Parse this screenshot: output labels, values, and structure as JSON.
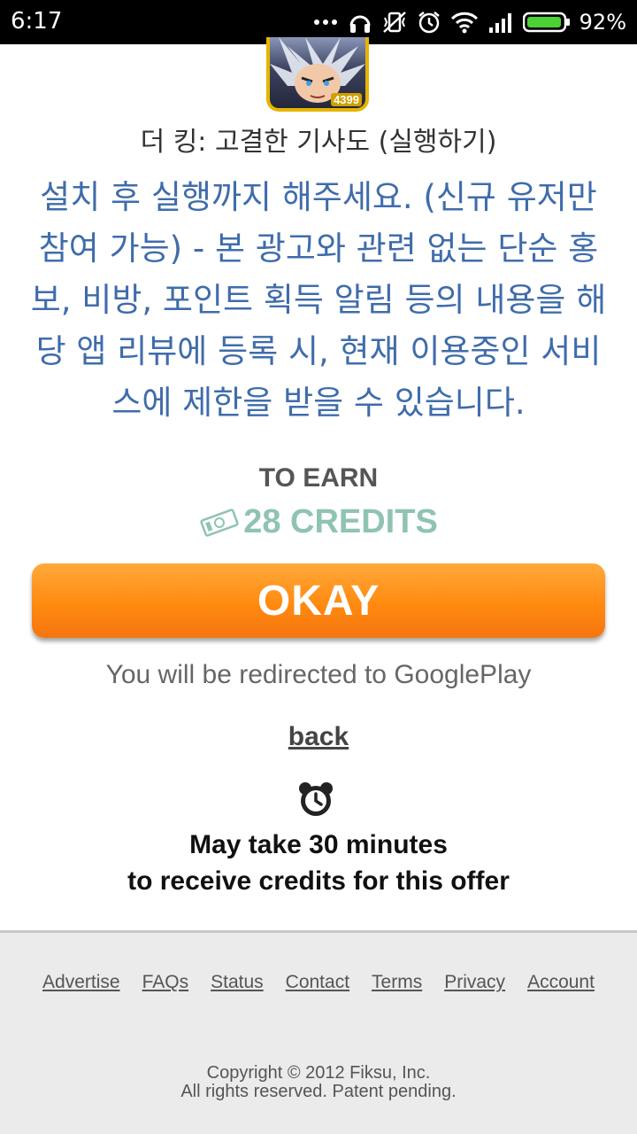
{
  "status_bar": {
    "time": "6:17",
    "battery": "92%",
    "icons": [
      "more-icon",
      "headset-icon",
      "vibrate-off-icon",
      "alarm-icon",
      "wifi-icon",
      "signal-icon",
      "battery-icon"
    ]
  },
  "app": {
    "icon": "game-icon",
    "badge": "4399",
    "title": "더 킹: 고결한 기사도 (실행하기)"
  },
  "offer": {
    "description": "설치 후 실행까지 해주세요. (신규 유저만 참여 가능) - 본 광고와 관련 없는 단순 홍보, 비방, 포인트 획득 알림 등의 내용을 해당 앱 리뷰에 등록 시, 현재 이용중인 서비스에 제한을 받을 수 있습니다.",
    "to_earn": "TO EARN",
    "credits": "28 CREDITS",
    "credits_icon": "money-icon",
    "okay_label": "OKAY",
    "redirect_text": "You will be redirected to GooglePlay",
    "back_label": "back",
    "wait_icon": "alarm-clock-icon",
    "wait_line1": "May take 30 minutes",
    "wait_line2": "to receive credits for this offer"
  },
  "footer": {
    "links": [
      "Advertise",
      "FAQs",
      "Status",
      "Contact",
      "Terms",
      "Privacy",
      "Account"
    ],
    "copyright_line1": "Copyright © 2012 Fiksu, Inc.",
    "copyright_line2": "All rights reserved. Patent pending."
  },
  "colors": {
    "accent_orange": "#ff8a10",
    "description_blue": "#3f6cab",
    "credits_green": "#8fc3b3"
  }
}
